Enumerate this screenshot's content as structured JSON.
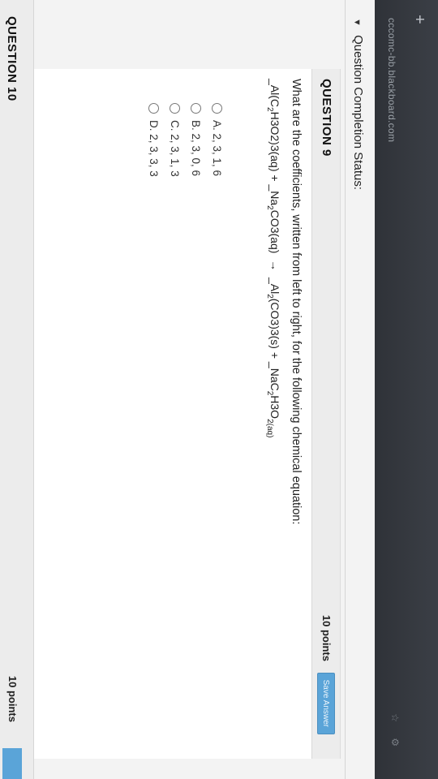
{
  "browser": {
    "new_tab_symbol": "+",
    "url": "cccomc-bb.blackboard.com"
  },
  "completion": {
    "label": "Question Completion Status:"
  },
  "question": {
    "title": "QUESTION 9",
    "points": "10 points",
    "save_label": "Save Answer",
    "text": "What are the coefficients, written from left to right, for the following chemical equation:",
    "options": [
      {
        "label": "A. 2, 3, 1, 6"
      },
      {
        "label": "B. 2, 3, 0, 6"
      },
      {
        "label": "C. 2, 3, 1, 3"
      },
      {
        "label": "D. 2, 3, 3, 3"
      }
    ]
  },
  "next_question": {
    "title": "QUESTION 10",
    "points": "10 points"
  }
}
